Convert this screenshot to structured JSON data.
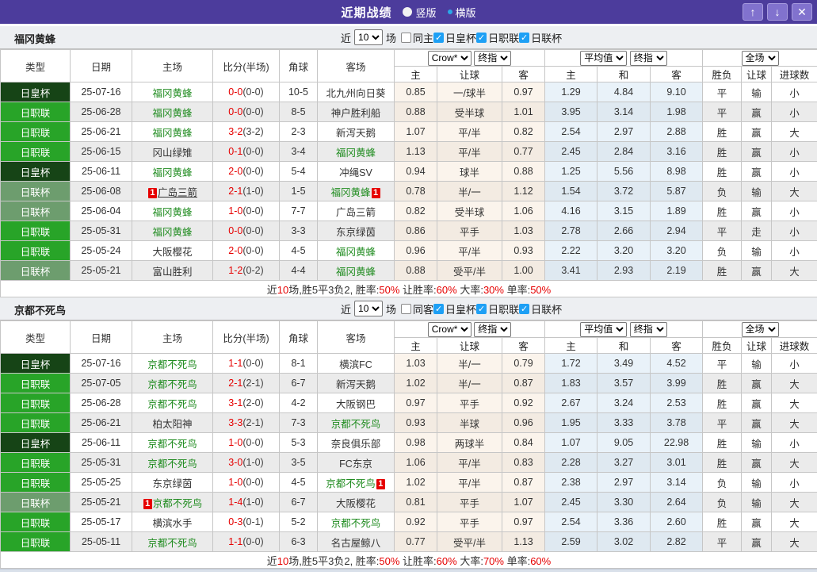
{
  "colors": {
    "titlebar_purple": "#4c3c9c",
    "titlebar_button_purple": "#8172ce",
    "radio_ring_blue": "#2aa8e8",
    "checkbox_blue": "#1ea0f5",
    "team_green": "#208c20",
    "win_red": "#e60000",
    "lose_blue": "#3a3ad0",
    "draw_green": "#1fa31f",
    "typeColors": {
      "日皇杯": "#164416",
      "日职联": "#28a428",
      "日联杯": "#6d9d6e"
    }
  },
  "resultColors": {
    "胜": "red",
    "平": "green",
    "负": "blue",
    "赢": "red",
    "走": "green",
    "输": "blue",
    "大": "red",
    "小": "blue"
  },
  "titlebar": {
    "title": "近期战绩",
    "radio_vertical": "竖版",
    "radio_horizontal": "横版",
    "up_glyph": "↑",
    "down_glyph": "↓",
    "close_glyph": "✕"
  },
  "filter": {
    "near": "近",
    "games": "10",
    "games_suffix": "场"
  },
  "columns": {
    "type": "类型",
    "date": "日期",
    "home": "主场",
    "score": "比分(半场)",
    "corner": "角球",
    "away": "客场",
    "crow_select": "Crow*",
    "crow_mode": "终指",
    "avg_select": "平均值",
    "avg_mode": "终指",
    "scope_select": "全场",
    "sub": [
      "主",
      "让球",
      "客",
      "主",
      "和",
      "客",
      "胜负",
      "让球",
      "进球数"
    ]
  },
  "sections": [
    {
      "team": "福冈黄蜂",
      "same_label": "同主",
      "cups": [
        "日皇杯",
        "日职联",
        "日联杯"
      ],
      "rows": [
        {
          "type": "日皇杯",
          "date": "25-07-16",
          "home": {
            "name": "福冈黄蜂",
            "green": true
          },
          "score": {
            "ft": "0-0",
            "ht": "(0-0)"
          },
          "corner": "10-5",
          "away": {
            "name": "北九州向日葵"
          },
          "crow": [
            "0.85",
            "一/球半",
            "0.97"
          ],
          "avg": [
            "1.29",
            "4.84",
            "9.10"
          ],
          "res": [
            "平",
            "输",
            "小"
          ]
        },
        {
          "type": "日职联",
          "date": "25-06-28",
          "home": {
            "name": "福冈黄蜂",
            "green": true
          },
          "score": {
            "ft": "0-0",
            "ht": "(0-0)"
          },
          "corner": "8-5",
          "away": {
            "name": "神户胜利船"
          },
          "crow": [
            "0.88",
            "受半球",
            "1.01"
          ],
          "avg": [
            "3.95",
            "3.14",
            "1.98"
          ],
          "res": [
            "平",
            "赢",
            "小"
          ]
        },
        {
          "type": "日职联",
          "date": "25-06-21",
          "home": {
            "name": "福冈黄蜂",
            "green": true
          },
          "score": {
            "ft": "3-2",
            "ht": "(3-2)"
          },
          "corner": "2-3",
          "away": {
            "name": "新泻天鹅"
          },
          "crow": [
            "1.07",
            "平/半",
            "0.82"
          ],
          "avg": [
            "2.54",
            "2.97",
            "2.88"
          ],
          "res": [
            "胜",
            "赢",
            "大"
          ]
        },
        {
          "type": "日职联",
          "date": "25-06-15",
          "home": {
            "name": "冈山绿雉"
          },
          "score": {
            "ft": "0-1",
            "ht": "(0-0)"
          },
          "corner": "3-4",
          "away": {
            "name": "福冈黄蜂",
            "green": true
          },
          "crow": [
            "1.13",
            "平/半",
            "0.77"
          ],
          "avg": [
            "2.45",
            "2.84",
            "3.16"
          ],
          "res": [
            "胜",
            "赢",
            "小"
          ]
        },
        {
          "type": "日皇杯",
          "date": "25-06-11",
          "home": {
            "name": "福冈黄蜂",
            "green": true
          },
          "score": {
            "ft": "2-0",
            "ht": "(0-0)"
          },
          "corner": "5-4",
          "away": {
            "name": "冲绳SV"
          },
          "crow": [
            "0.94",
            "球半",
            "0.88"
          ],
          "avg": [
            "1.25",
            "5.56",
            "8.98"
          ],
          "res": [
            "胜",
            "赢",
            "小"
          ]
        },
        {
          "type": "日联杯",
          "date": "25-06-08",
          "home": {
            "name": "广岛三箭",
            "badge": "1",
            "badge_pos": "before",
            "underline": true
          },
          "score": {
            "ft": "2-1",
            "ht": "(1-0)"
          },
          "corner": "1-5",
          "away": {
            "name": "福冈黄蜂",
            "green": true,
            "badge": "1",
            "badge_pos": "after"
          },
          "crow": [
            "0.78",
            "半/一",
            "1.12"
          ],
          "avg": [
            "1.54",
            "3.72",
            "5.87"
          ],
          "res": [
            "负",
            "输",
            "大"
          ]
        },
        {
          "type": "日联杯",
          "date": "25-06-04",
          "home": {
            "name": "福冈黄蜂",
            "green": true
          },
          "score": {
            "ft": "1-0",
            "ht": "(0-0)"
          },
          "corner": "7-7",
          "away": {
            "name": "广岛三箭"
          },
          "crow": [
            "0.82",
            "受半球",
            "1.06"
          ],
          "avg": [
            "4.16",
            "3.15",
            "1.89"
          ],
          "res": [
            "胜",
            "赢",
            "小"
          ]
        },
        {
          "type": "日职联",
          "date": "25-05-31",
          "home": {
            "name": "福冈黄蜂",
            "green": true
          },
          "score": {
            "ft": "0-0",
            "ht": "(0-0)"
          },
          "corner": "3-3",
          "away": {
            "name": "东京绿茵"
          },
          "crow": [
            "0.86",
            "平手",
            "1.03"
          ],
          "avg": [
            "2.78",
            "2.66",
            "2.94"
          ],
          "res": [
            "平",
            "走",
            "小"
          ]
        },
        {
          "type": "日职联",
          "date": "25-05-24",
          "home": {
            "name": "大阪樱花"
          },
          "score": {
            "ft": "2-0",
            "ht": "(0-0)"
          },
          "corner": "4-5",
          "away": {
            "name": "福冈黄蜂",
            "green": true
          },
          "crow": [
            "0.96",
            "平/半",
            "0.93"
          ],
          "avg": [
            "2.22",
            "3.20",
            "3.20"
          ],
          "res": [
            "负",
            "输",
            "小"
          ]
        },
        {
          "type": "日联杯",
          "date": "25-05-21",
          "home": {
            "name": "富山胜利"
          },
          "score": {
            "ft": "1-2",
            "ht": "(0-2)"
          },
          "corner": "4-4",
          "away": {
            "name": "福冈黄蜂",
            "green": true
          },
          "crow": [
            "0.88",
            "受平/半",
            "1.00"
          ],
          "avg": [
            "3.41",
            "2.93",
            "2.19"
          ],
          "res": [
            "胜",
            "赢",
            "大"
          ]
        }
      ],
      "summary": [
        {
          "t": "近"
        },
        {
          "t": "10",
          "red": true
        },
        {
          "t": "场,胜5平3负2, 胜率:"
        },
        {
          "t": "50%",
          "red": true
        },
        {
          "t": " 让胜率:"
        },
        {
          "t": "60%",
          "red": true
        },
        {
          "t": " 大率:"
        },
        {
          "t": "30%",
          "red": true
        },
        {
          "t": " 单率:"
        },
        {
          "t": "50%",
          "red": true
        }
      ]
    },
    {
      "team": "京都不死鸟",
      "same_label": "同客",
      "cups": [
        "日皇杯",
        "日职联",
        "日联杯"
      ],
      "rows": [
        {
          "type": "日皇杯",
          "date": "25-07-16",
          "home": {
            "name": "京都不死鸟",
            "green": true
          },
          "score": {
            "ft": "1-1",
            "ht": "(0-0)"
          },
          "corner": "8-1",
          "away": {
            "name": "横滨FC"
          },
          "crow": [
            "1.03",
            "半/一",
            "0.79"
          ],
          "avg": [
            "1.72",
            "3.49",
            "4.52"
          ],
          "res": [
            "平",
            "输",
            "小"
          ]
        },
        {
          "type": "日职联",
          "date": "25-07-05",
          "home": {
            "name": "京都不死鸟",
            "green": true
          },
          "score": {
            "ft": "2-1",
            "ht": "(2-1)"
          },
          "corner": "6-7",
          "away": {
            "name": "新泻天鹅"
          },
          "crow": [
            "1.02",
            "半/一",
            "0.87"
          ],
          "avg": [
            "1.83",
            "3.57",
            "3.99"
          ],
          "res": [
            "胜",
            "赢",
            "大"
          ]
        },
        {
          "type": "日职联",
          "date": "25-06-28",
          "home": {
            "name": "京都不死鸟",
            "green": true
          },
          "score": {
            "ft": "3-1",
            "ht": "(2-0)"
          },
          "corner": "4-2",
          "away": {
            "name": "大阪钢巴"
          },
          "crow": [
            "0.97",
            "平手",
            "0.92"
          ],
          "avg": [
            "2.67",
            "3.24",
            "2.53"
          ],
          "res": [
            "胜",
            "赢",
            "大"
          ]
        },
        {
          "type": "日职联",
          "date": "25-06-21",
          "home": {
            "name": "柏太阳神"
          },
          "score": {
            "ft": "3-3",
            "ht": "(2-1)"
          },
          "corner": "7-3",
          "away": {
            "name": "京都不死鸟",
            "green": true
          },
          "crow": [
            "0.93",
            "半球",
            "0.96"
          ],
          "avg": [
            "1.95",
            "3.33",
            "3.78"
          ],
          "res": [
            "平",
            "赢",
            "大"
          ]
        },
        {
          "type": "日皇杯",
          "date": "25-06-11",
          "home": {
            "name": "京都不死鸟",
            "green": true
          },
          "score": {
            "ft": "1-0",
            "ht": "(0-0)"
          },
          "corner": "5-3",
          "away": {
            "name": "奈良俱乐部"
          },
          "crow": [
            "0.98",
            "两球半",
            "0.84"
          ],
          "avg": [
            "1.07",
            "9.05",
            "22.98"
          ],
          "res": [
            "胜",
            "输",
            "小"
          ]
        },
        {
          "type": "日职联",
          "date": "25-05-31",
          "home": {
            "name": "京都不死鸟",
            "green": true
          },
          "score": {
            "ft": "3-0",
            "ht": "(1-0)"
          },
          "corner": "3-5",
          "away": {
            "name": "FC东京"
          },
          "crow": [
            "1.06",
            "平/半",
            "0.83"
          ],
          "avg": [
            "2.28",
            "3.27",
            "3.01"
          ],
          "res": [
            "胜",
            "赢",
            "大"
          ]
        },
        {
          "type": "日职联",
          "date": "25-05-25",
          "home": {
            "name": "东京绿茵"
          },
          "score": {
            "ft": "1-0",
            "ht": "(0-0)"
          },
          "corner": "4-5",
          "away": {
            "name": "京都不死鸟",
            "green": true,
            "badge": "1",
            "badge_pos": "after"
          },
          "crow": [
            "1.02",
            "平/半",
            "0.87"
          ],
          "avg": [
            "2.38",
            "2.97",
            "3.14"
          ],
          "res": [
            "负",
            "输",
            "小"
          ]
        },
        {
          "type": "日联杯",
          "date": "25-05-21",
          "home": {
            "name": "京都不死鸟",
            "green": true,
            "badge": "1",
            "badge_pos": "before"
          },
          "score": {
            "ft": "1-4",
            "ht": "(1-0)"
          },
          "corner": "6-7",
          "away": {
            "name": "大阪樱花"
          },
          "crow": [
            "0.81",
            "平手",
            "1.07"
          ],
          "avg": [
            "2.45",
            "3.30",
            "2.64"
          ],
          "res": [
            "负",
            "输",
            "大"
          ]
        },
        {
          "type": "日职联",
          "date": "25-05-17",
          "home": {
            "name": "横滨水手"
          },
          "score": {
            "ft": "0-3",
            "ht": "(0-1)"
          },
          "corner": "5-2",
          "away": {
            "name": "京都不死鸟",
            "green": true
          },
          "crow": [
            "0.92",
            "平手",
            "0.97"
          ],
          "avg": [
            "2.54",
            "3.36",
            "2.60"
          ],
          "res": [
            "胜",
            "赢",
            "大"
          ]
        },
        {
          "type": "日职联",
          "date": "25-05-11",
          "home": {
            "name": "京都不死鸟",
            "green": true
          },
          "score": {
            "ft": "1-1",
            "ht": "(0-0)"
          },
          "corner": "6-3",
          "away": {
            "name": "名古屋鲸八"
          },
          "crow": [
            "0.77",
            "受平/半",
            "1.13"
          ],
          "avg": [
            "2.59",
            "3.02",
            "2.82"
          ],
          "res": [
            "平",
            "赢",
            "大"
          ]
        }
      ],
      "summary": [
        {
          "t": "近"
        },
        {
          "t": "10",
          "red": true
        },
        {
          "t": "场,胜5平3负2, 胜率:"
        },
        {
          "t": "50%",
          "red": true
        },
        {
          "t": " 让胜率:"
        },
        {
          "t": "60%",
          "red": true
        },
        {
          "t": " 大率:"
        },
        {
          "t": "70%",
          "red": true
        },
        {
          "t": " 单率:"
        },
        {
          "t": "60%",
          "red": true
        }
      ]
    }
  ]
}
